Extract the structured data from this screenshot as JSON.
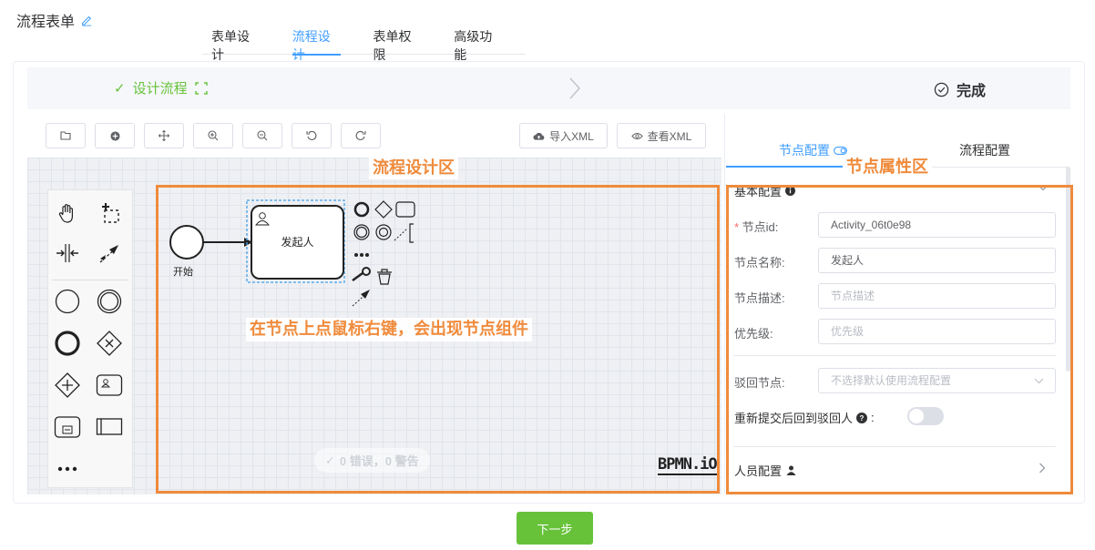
{
  "page": {
    "title": "流程表单"
  },
  "tabs": [
    "表单设计",
    "流程设计",
    "表单权限",
    "高级功能"
  ],
  "steps": {
    "step1": "设计流程",
    "step2": "完成"
  },
  "toolbar": {
    "import_xml": "导入XML",
    "view_xml": "查看XML"
  },
  "canvas": {
    "start_label": "开始",
    "task_label": "发起人",
    "status": "0 错误，0 警告",
    "logo": "BPMN.iO"
  },
  "annotations": {
    "design_area": "流程设计区",
    "context_hint": "在节点上点鼠标右键，会出现节点组件",
    "property_area": "节点属性区"
  },
  "panel": {
    "tab_node": "节点配置",
    "tab_process": "流程配置",
    "basic_section": "基本配置",
    "fields": {
      "node_id_label": "节点id:",
      "node_id_value": "Activity_06t0e98",
      "node_name_label": "节点名称:",
      "node_name_value": "发起人",
      "node_desc_label": "节点描述:",
      "node_desc_placeholder": "节点描述",
      "priority_label": "优先级:",
      "priority_placeholder": "优先级",
      "reject_label": "驳回节点:",
      "reject_placeholder": "不选择默认使用流程配置",
      "resubmit_label": "重新提交后回到驳回人",
      "resubmit_toggle": "off"
    },
    "personnel_section": "人员配置"
  },
  "footer": {
    "next": "下一步"
  },
  "colors": {
    "accent": "#409eff",
    "success": "#67c23a",
    "annotation": "#ef8b3c"
  }
}
